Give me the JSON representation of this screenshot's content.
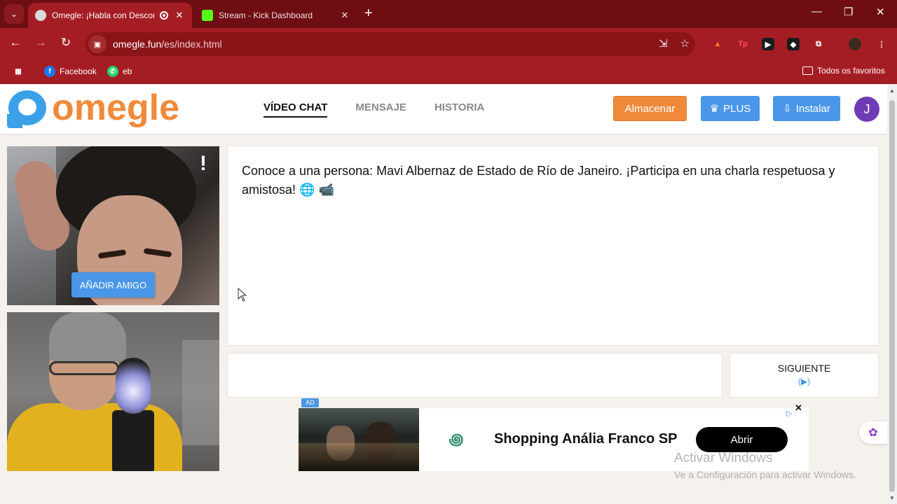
{
  "browser": {
    "tabs": [
      {
        "title": "Omegle: ¡Habla con Descon",
        "active": true
      },
      {
        "title": "Stream - Kick Dashboard",
        "active": false
      }
    ],
    "url_host": "omegle.fun",
    "url_path": "/es/index.html",
    "bookmarks": [
      {
        "label": "Facebook",
        "icon": "facebook-icon"
      },
      {
        "label": "eb",
        "icon": "whatsapp-icon"
      }
    ],
    "all_bookmarks_label": "Todos os favoritos",
    "accent": "#a51d24"
  },
  "site": {
    "logo_text": "omegle",
    "nav": [
      {
        "label": "VÍDEO CHAT",
        "active": true
      },
      {
        "label": "MENSAJE",
        "active": false
      },
      {
        "label": "HISTORIA",
        "active": false
      }
    ],
    "buttons": {
      "store": "Almacenar",
      "plus": "PLUS",
      "install": "Instalar"
    },
    "avatar_initial": "J"
  },
  "video": {
    "report_label": "!",
    "add_friend_label": "AÑADIR AMIGO"
  },
  "chat": {
    "message": "Conoce a una persona: Mavi Albernaz de Estado de Río de Janeiro. ¡Participa en una charla respetuosa y amistosa! 🌐 📹",
    "next_label": "SIGUIENTE",
    "next_key": "(▶)"
  },
  "ad": {
    "tag": "AD",
    "title": "Shopping Anália Franco SP",
    "button": "Abrir",
    "close": "✕"
  },
  "watermark": {
    "line1": "Activar Windows",
    "line2": "Ve a Configuración para activar Windows."
  }
}
